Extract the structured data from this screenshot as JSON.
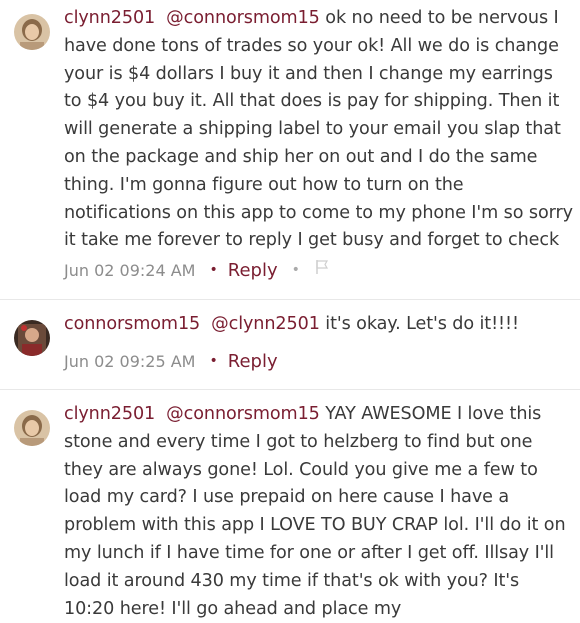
{
  "comments": [
    {
      "username": "clynn2501",
      "mention": "@connorsmom15",
      "body": " ok no need to be nervous I have done tons of trades so your ok! All we do is change your is $4 dollars I buy it and then I change my earrings to $4 you buy it. All that does is pay for shipping. Then it will generate a shipping label to your email you slap that on the package and ship her on out and I do the same thing. I'm gonna figure out how to turn on the notifications on this app to come to my phone I'm so sorry it take me forever to reply I get busy and forget to check",
      "timestamp": "Jun 02 09:24 AM",
      "reply_label": "Reply",
      "avatar_icon": "profile-photo"
    },
    {
      "username": "connorsmom15",
      "mention": "@clynn2501",
      "body": " it's okay. Let's do it!!!!",
      "timestamp": "Jun 02 09:25 AM",
      "reply_label": "Reply",
      "avatar_icon": "profile-photo"
    },
    {
      "username": "clynn2501",
      "mention": "@connorsmom15",
      "body": " YAY AWESOME I love this stone and every time I got to helzberg to find but one they are always gone! Lol. Could you give me a few to load my card? I use prepaid on here cause I have a problem with this app I LOVE TO BUY CRAP lol. I'll do it on my lunch if I have time for one or after I get off. Illsay I'll load it around 430 my time if that's ok with you? It's 10:20 here! I'll go ahead and place my",
      "avatar_icon": "profile-photo"
    }
  ],
  "colors": {
    "accent": "#7a1e31",
    "text": "#3a3a3a",
    "meta": "#8c8c8c"
  }
}
